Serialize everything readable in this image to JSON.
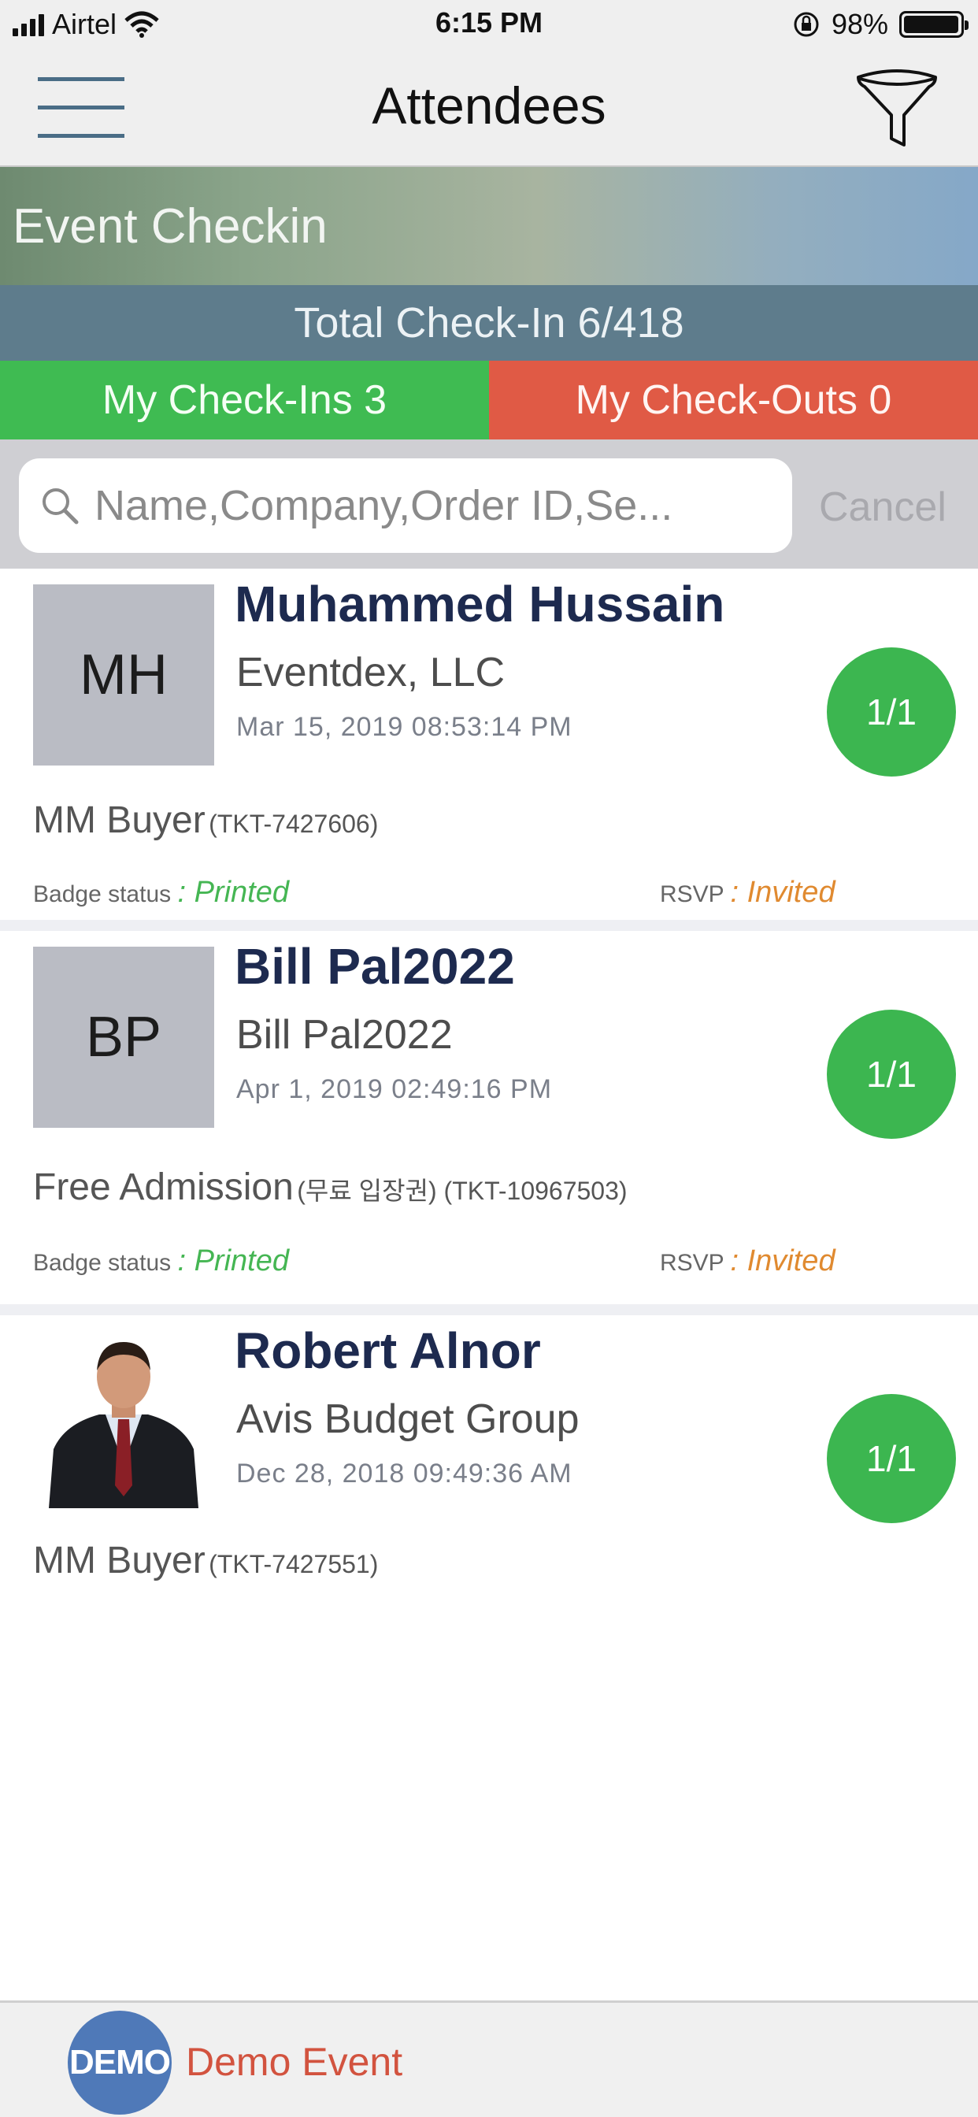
{
  "status_bar": {
    "carrier": "Airtel",
    "time": "6:15 PM",
    "battery": "98%",
    "battery_level": 0.98
  },
  "nav": {
    "title": "Attendees"
  },
  "banner": {
    "title": "Event Checkin"
  },
  "totals": {
    "total_checkin": "Total Check-In 6/418",
    "my_checkins": "My Check-Ins 3",
    "my_checkouts": "My Check-Outs 0"
  },
  "search": {
    "placeholder": "Name,Company,Order ID,Se...",
    "cancel_label": "Cancel"
  },
  "attendees": [
    {
      "initials": "MH",
      "name": "Muhammed Hussain",
      "company": "Eventdex, LLC",
      "date": "Mar 15, 2019 08:53:14 PM",
      "count": "1/1",
      "ticket_type": "MM Buyer",
      "ticket_id": "(TKT-7427606)",
      "badge_label": "Badge status",
      "badge_value": ": Printed",
      "rsvp_label": "RSVP",
      "rsvp_value": ": Invited"
    },
    {
      "initials": "BP",
      "name": "Bill Pal2022",
      "company": "Bill Pal2022",
      "date": "Apr 1, 2019 02:49:16 PM",
      "count": "1/1",
      "ticket_type": "Free Admission",
      "ticket_id": "(무료 입장권) (TKT-10967503)",
      "badge_label": "Badge status",
      "badge_value": ": Printed",
      "rsvp_label": "RSVP",
      "rsvp_value": ": Invited"
    },
    {
      "name": "Robert Alnor",
      "company": "Avis Budget Group",
      "date": "Dec 28, 2018 09:49:36 AM",
      "count": "1/1",
      "ticket_type": "MM Buyer",
      "ticket_id": "(TKT-7427551)"
    }
  ],
  "footer": {
    "logo_text": "DEMO",
    "event_name": "Demo Event"
  },
  "colors": {
    "check_in_green": "#3fbb52",
    "check_out_red": "#e05a45",
    "total_bar": "#5e7c8c",
    "name_navy": "#1d2a4f",
    "badge_printed": "#45b653",
    "rsvp_invited": "#e08a30"
  },
  "icons": {
    "menu": "hamburger-menu-icon",
    "filter": "filter-funnel-icon",
    "search": "magnifier-icon",
    "wifi": "wifi-icon",
    "signal": "cellular-signal-icon",
    "lock": "orientation-lock-icon",
    "battery": "battery-icon"
  }
}
